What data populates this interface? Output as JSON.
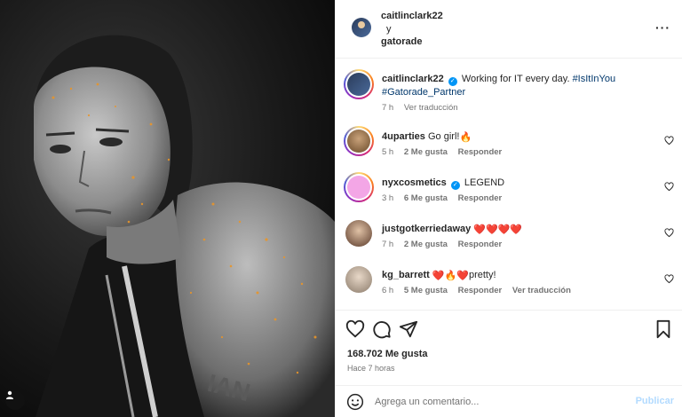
{
  "header": {
    "username": "caitlinclark22",
    "conjunction": "y",
    "collab_username": "gatorade",
    "more_icon": "more-horizontal-icon"
  },
  "caption": {
    "username": "caitlinclark22",
    "verified": true,
    "text": "Working for IT every day.",
    "hashtag1": "#IsItInYou",
    "hashtag2": "#Gatorade_Partner",
    "time": "7 h",
    "translate": "Ver traducción"
  },
  "comments": [
    {
      "username": "4uparties",
      "verified": false,
      "text": "Go girl!",
      "emoji": "🔥",
      "time": "5 h",
      "likes": "2 Me gusta",
      "reply": "Responder"
    },
    {
      "username": "nyxcosmetics",
      "verified": true,
      "text": "LEGEND",
      "emoji": "",
      "time": "3 h",
      "likes": "6 Me gusta",
      "reply": "Responder"
    },
    {
      "username": "justgotkerriedaway",
      "verified": false,
      "text": "",
      "emoji": "❤️❤️❤️❤️",
      "time": "7 h",
      "likes": "2 Me gusta",
      "reply": "Responder"
    },
    {
      "username": "kg_barrett",
      "verified": false,
      "text": "pretty!",
      "emoji": "❤️🔥❤️",
      "time": "6 h",
      "likes": "5 Me gusta",
      "reply": "Responder",
      "translate": "Ver traducción"
    }
  ],
  "actions": {
    "likes": "168.702 Me gusta",
    "time": "Hace 7 horas"
  },
  "composer": {
    "placeholder": "Agrega un comentario...",
    "publish": "Publicar"
  },
  "colors": {
    "link": "#00376b",
    "verified": "#0095f6",
    "publish_disabled": "#b3dbff",
    "heart_red": "#ed4956",
    "paint_speckle": "#e8952a"
  }
}
